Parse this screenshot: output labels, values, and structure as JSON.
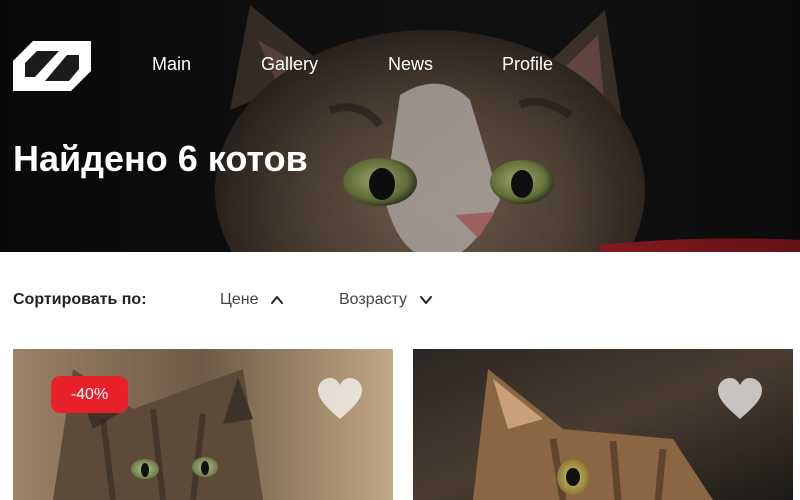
{
  "nav": {
    "items": [
      {
        "label": "Main"
      },
      {
        "label": "Gallery"
      },
      {
        "label": "News"
      },
      {
        "label": "Profile"
      }
    ]
  },
  "page": {
    "title": "Найдено 6 котов"
  },
  "sort": {
    "label": "Сортировать по:",
    "options": [
      {
        "label": "Цене",
        "icon": "chevron-up-icon"
      },
      {
        "label": "Возрасту",
        "icon": "chevron-down-icon"
      }
    ]
  },
  "cards": [
    {
      "badge": "-40%",
      "favorite_icon": "heart-icon",
      "badge_color": "#e8202a"
    },
    {
      "favorite_icon": "heart-icon"
    }
  ],
  "colors": {
    "accent": "#e8202a",
    "text_dark": "#222222"
  }
}
